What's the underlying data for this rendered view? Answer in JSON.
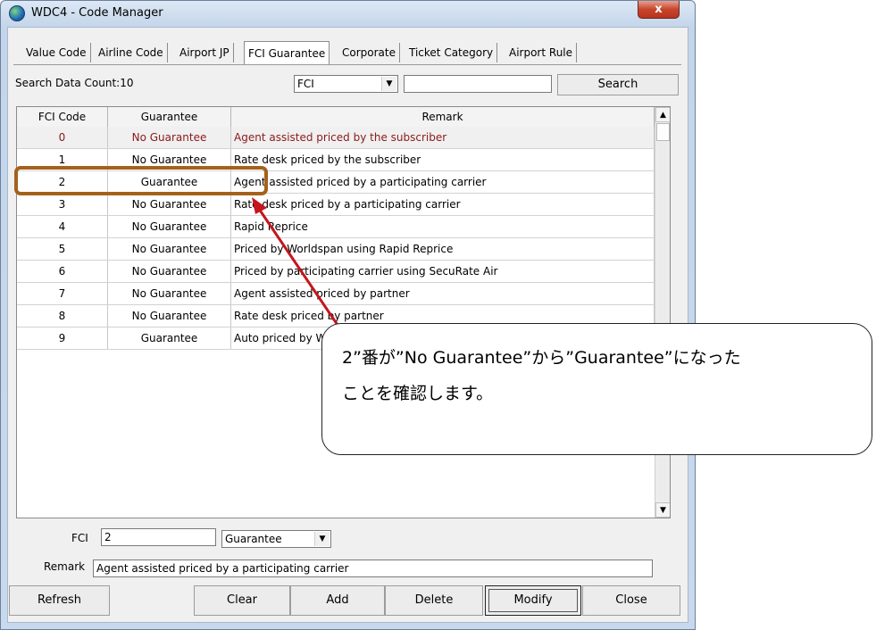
{
  "window": {
    "title": "WDC4 - Code Manager",
    "close_label": "x",
    "icon": "globe-icon"
  },
  "tabs": [
    {
      "label": "Value Code"
    },
    {
      "label": "Airline Code"
    },
    {
      "label": "Airport JP"
    },
    {
      "label": "FCI Guarantee"
    },
    {
      "label": "Corporate"
    },
    {
      "label": "Ticket Category"
    },
    {
      "label": "Airport Rule"
    }
  ],
  "search": {
    "count_text": "Search Data Count:10",
    "field_value": "FCI",
    "query_value": "",
    "button_label": "Search"
  },
  "grid": {
    "columns": [
      "FCI Code",
      "Guarantee",
      "Remark"
    ],
    "rows": [
      {
        "code": "0",
        "guarantee": "No Guarantee",
        "remark": "Agent assisted priced by the subscriber"
      },
      {
        "code": "1",
        "guarantee": "No Guarantee",
        "remark": "Rate desk priced by the subscriber"
      },
      {
        "code": "2",
        "guarantee": "Guarantee",
        "remark": "Agent assisted priced by a participating carrier"
      },
      {
        "code": "3",
        "guarantee": "No Guarantee",
        "remark": "Rate desk priced by a participating carrier"
      },
      {
        "code": "4",
        "guarantee": "No Guarantee",
        "remark": "Rapid Reprice"
      },
      {
        "code": "5",
        "guarantee": "No Guarantee",
        "remark": "Priced by Worldspan using Rapid Reprice"
      },
      {
        "code": "6",
        "guarantee": "No Guarantee",
        "remark": "Priced by participating carrier using SecuRate Air"
      },
      {
        "code": "7",
        "guarantee": "No Guarantee",
        "remark": "Agent assisted priced by partner"
      },
      {
        "code": "8",
        "guarantee": "No Guarantee",
        "remark": "Rate desk priced by partner"
      },
      {
        "code": "9",
        "guarantee": "Guarantee",
        "remark": "Auto priced by W"
      }
    ]
  },
  "form": {
    "fci_label": "FCI",
    "fci_value": "2",
    "guarantee_value": "Guarantee",
    "remark_label": "Remark",
    "remark_value": "Agent assisted priced by a participating carrier"
  },
  "buttons": {
    "refresh": "Refresh",
    "clear": "Clear",
    "add": "Add",
    "delete": "Delete",
    "modify": "Modify",
    "close": "Close"
  },
  "annotation": {
    "line1": "2”番が”No  Guarantee”から”Guarantee”になった",
    "line2": "ことを確認します。"
  },
  "colors": {
    "highlight": "#a5611c",
    "arrow": "#c4161c",
    "selected_text": "#8b1a1a"
  }
}
